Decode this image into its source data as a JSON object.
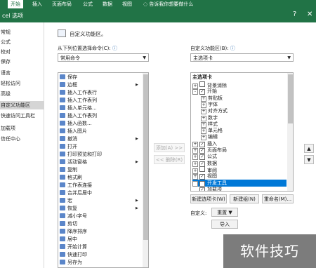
{
  "ribbon": {
    "tabs": [
      "开始",
      "插入",
      "页面布局",
      "公式",
      "数据",
      "视图"
    ],
    "tellme": "告诉我你想要做什么"
  },
  "title": {
    "text": "cel 选项",
    "help": "?",
    "close": "✕"
  },
  "nav": {
    "items": [
      "常规",
      "公式",
      "校对",
      "保存",
      "语言",
      "轻松访问",
      "高级",
      "自定义功能区",
      "快速访问工具栏",
      "加载项",
      "信任中心"
    ],
    "selected_index": 7
  },
  "main": {
    "heading": "自定义功能区。",
    "left_label": "从下列位置选择命令(C):",
    "left_select_value": "常用命令",
    "right_label": "自定义功能区(B):",
    "right_select_value": "主选项卡",
    "add_button": "添加(A) >>",
    "remove_button": "<< 删除(R)",
    "commands": [
      {
        "label": "保存",
        "icon": "save-icon",
        "sub": false
      },
      {
        "label": "边框",
        "icon": "border-icon",
        "sub": true
      },
      {
        "label": "插入工作表行",
        "icon": "insert-row-icon",
        "sub": false
      },
      {
        "label": "插入工作表列",
        "icon": "insert-col-icon",
        "sub": false
      },
      {
        "label": "插入单元格...",
        "icon": "insert-cell-icon",
        "sub": false
      },
      {
        "label": "插入工作表列",
        "icon": "insert-col-icon",
        "sub": false
      },
      {
        "label": "插入函数...",
        "icon": "function-icon",
        "sub": false
      },
      {
        "label": "插入图片",
        "icon": "picture-icon",
        "sub": false
      },
      {
        "label": "撤消",
        "icon": "undo-icon",
        "sub": true
      },
      {
        "label": "打开",
        "icon": "open-icon",
        "sub": false
      },
      {
        "label": "打印预览和打印",
        "icon": "print-icon",
        "sub": false
      },
      {
        "label": "活动窗格",
        "icon": "pane-icon",
        "sub": true
      },
      {
        "label": "复制",
        "icon": "copy-icon",
        "sub": false
      },
      {
        "label": "格式刷",
        "icon": "format-painter-icon",
        "sub": false
      },
      {
        "label": "工作表连接",
        "icon": "connection-icon",
        "sub": false
      },
      {
        "label": "合并后居中",
        "icon": "merge-icon",
        "sub": false
      },
      {
        "label": "宏",
        "icon": "macro-icon",
        "sub": true
      },
      {
        "label": "恢复",
        "icon": "redo-icon",
        "sub": true
      },
      {
        "label": "减小字号",
        "icon": "font-down-icon",
        "sub": false
      },
      {
        "label": "剪切",
        "icon": "cut-icon",
        "sub": false
      },
      {
        "label": "降序排序",
        "icon": "sort-desc-icon",
        "sub": false
      },
      {
        "label": "居中",
        "icon": "center-icon",
        "sub": false
      },
      {
        "label": "开始计算",
        "icon": "calc-icon",
        "sub": false
      },
      {
        "label": "快速打印",
        "icon": "quick-print-icon",
        "sub": false
      },
      {
        "label": "另存为",
        "icon": "save-as-icon",
        "sub": false
      }
    ],
    "tree_header": "主选项卡",
    "tree": [
      {
        "label": "背景消除",
        "level": 0,
        "expander": "+",
        "checked": false
      },
      {
        "label": "开始",
        "level": 0,
        "expander": "-",
        "checked": true
      },
      {
        "label": "剪贴板",
        "level": 1,
        "expander": "+",
        "checked": null
      },
      {
        "label": "字体",
        "level": 1,
        "expander": "+",
        "checked": null
      },
      {
        "label": "对齐方式",
        "level": 1,
        "expander": "+",
        "checked": null
      },
      {
        "label": "数字",
        "level": 1,
        "expander": "+",
        "checked": null
      },
      {
        "label": "样式",
        "level": 1,
        "expander": "+",
        "checked": null
      },
      {
        "label": "单元格",
        "level": 1,
        "expander": "+",
        "checked": null
      },
      {
        "label": "编辑",
        "level": 1,
        "expander": "+",
        "checked": null
      },
      {
        "label": "插入",
        "level": 0,
        "expander": "+",
        "checked": true
      },
      {
        "label": "页面布局",
        "level": 0,
        "expander": "+",
        "checked": true
      },
      {
        "label": "公式",
        "level": 0,
        "expander": "+",
        "checked": true
      },
      {
        "label": "数据",
        "level": 0,
        "expander": "+",
        "checked": true
      },
      {
        "label": "审阅",
        "level": 0,
        "expander": "+",
        "checked": false
      },
      {
        "label": "视图",
        "level": 0,
        "expander": "+",
        "checked": true
      },
      {
        "label": "开发工具",
        "level": 0,
        "expander": "+",
        "checked": true,
        "highlight": true
      },
      {
        "label": "加载项",
        "level": 0,
        "expander": "",
        "checked": true
      }
    ],
    "new_tab_button": "新建选项卡(W)",
    "new_group_button": "新建组(N)",
    "rename_button": "重命名(M)...",
    "customize_label": "自定义:",
    "reset_button": "重置",
    "import_button": "导入"
  },
  "watermark": "软件技巧",
  "colors": {
    "accent": "#217346",
    "selection": "#0078d7"
  }
}
